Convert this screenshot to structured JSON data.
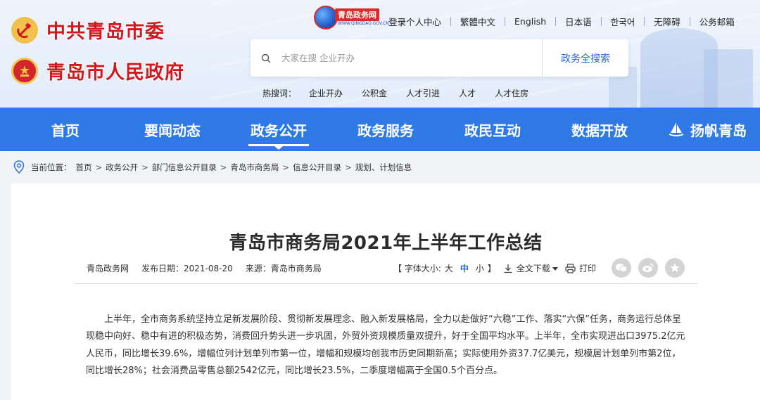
{
  "brand": {
    "party_name": "中共青岛市委",
    "gov_name": "青岛市人民政府",
    "portal_title": "青岛政务网",
    "portal_url": "WWW.QINGDAO.GOV.CN",
    "accent_red": "#d0191f",
    "nav_blue": "#2f79e7",
    "link_blue": "#2a66d9"
  },
  "toplinks": [
    "登录个人中心",
    "繁體中文",
    "English",
    "日本语",
    "한국어",
    "无障碍",
    "公务邮箱"
  ],
  "search": {
    "placeholder": "大家在搜 企业开办",
    "button": "政务全搜索",
    "hot_label": "热搜词：",
    "hot_words": [
      "企业开办",
      "公积金",
      "人才引进",
      "人才",
      "人才住房"
    ]
  },
  "nav": {
    "items": [
      "首页",
      "要闻动态",
      "政务公开",
      "政务服务",
      "政民互动",
      "数据开放",
      "扬帆青岛"
    ],
    "active_index": 2
  },
  "breadcrumb": {
    "label": "当前位置：",
    "items": [
      "首页",
      "政务公开",
      "部门信息公开目录",
      "青岛市商务局",
      "信息公开目录",
      "规划、计划信息"
    ],
    "separator": ">"
  },
  "article": {
    "title": "青岛市商务局2021年上半年工作总结",
    "site": "青岛政务网",
    "date": "发布日期：2021-08-20",
    "source": "来源：青岛市商务局",
    "font_size_label": "【 字体大小:",
    "size_large": "大",
    "size_medium": "中",
    "size_small": "小",
    "font_size_close": "】",
    "download": "全文下载",
    "print": "打印",
    "share_icons": [
      "wechat-icon",
      "weibo-icon",
      "favorite-icon"
    ],
    "paragraph": "上半年，全市商务系统坚持立足新发展阶段、贯彻新发展理念、融入新发展格局，全力以赴做好“六稳”工作、落实“六保”任务，商务运行总体呈现稳中向好、稳中有进的积极态势，消费回升势头进一步巩固，外贸外资规模质量双提升，好于全国平均水平。上半年，全市实现进出口3975.2亿元人民币，同比增长39.6%，增幅位列计划单列市第一位，增幅和规模均创我市历史同期新高；实际使用外资37.7亿美元，规模居计划单列市第2位，同比增长28%；社会消费品零售总额2542亿元，同比增长23.5%，二季度增幅高于全国0.5个百分点。"
  }
}
